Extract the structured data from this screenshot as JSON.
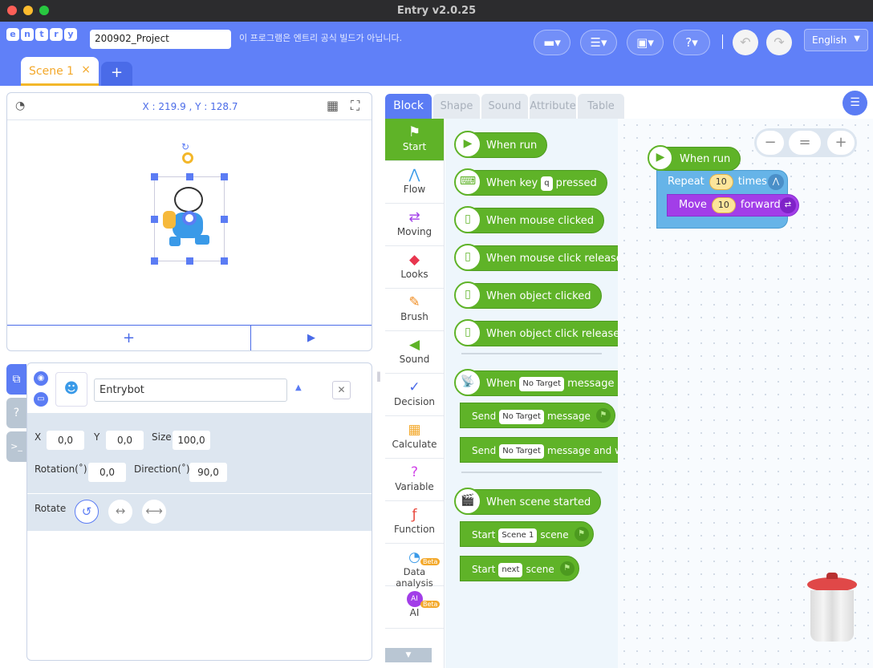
{
  "window": {
    "title": "Entry v2.0.25"
  },
  "header": {
    "logo": "entry",
    "project_name": "200902_Project",
    "notice": "이 프로그램은 엔트리 공식 빌드가 아닙니다.",
    "language": "English",
    "menus": [
      "block-style",
      "file",
      "save",
      "help"
    ]
  },
  "scenes": {
    "tabs": [
      {
        "label": "Scene 1",
        "close": "×"
      }
    ],
    "add": "+"
  },
  "stage": {
    "coords": "X : 219.9 , Y : 128.7",
    "add_button": "+",
    "play_button": "▶"
  },
  "object": {
    "name": "Entrybot",
    "x_label": "X",
    "x": "0,0",
    "y_label": "Y",
    "y": "0,0",
    "size_label": "Size",
    "size": "100,0",
    "rotation_label": "Rotation(˚)",
    "rotation": "0,0",
    "direction_label": "Direction(˚)",
    "direction": "90,0",
    "rotate_label": "Rotate",
    "side_tabs": [
      "object",
      "help",
      "console"
    ]
  },
  "block_tabs": [
    "Block",
    "Shape",
    "Sound",
    "Attribute",
    "Table"
  ],
  "categories": [
    {
      "label": "Start",
      "icon": "⚑"
    },
    {
      "label": "Flow",
      "icon": "⋀"
    },
    {
      "label": "Moving",
      "icon": "⇄"
    },
    {
      "label": "Looks",
      "icon": "◆"
    },
    {
      "label": "Brush",
      "icon": "✎"
    },
    {
      "label": "Sound",
      "icon": "◀"
    },
    {
      "label": "Decision",
      "icon": "✓"
    },
    {
      "label": "Calculate",
      "icon": "▦"
    },
    {
      "label": "Variable",
      "icon": "?"
    },
    {
      "label": "Function",
      "icon": "ƒ"
    },
    {
      "label": "Data analysis",
      "icon": "◔",
      "badge": "Beta"
    },
    {
      "label": "AI",
      "icon": "AI",
      "badge": "Beta"
    }
  ],
  "palette": {
    "when_run": "When run",
    "when_key": [
      "When key",
      "q",
      "pressed"
    ],
    "mouse_clicked": "When mouse clicked",
    "mouse_released": "When mouse click released",
    "object_clicked": "When object clicked",
    "object_released": "When object click released",
    "msg_received": [
      "When",
      "No Target",
      "message received"
    ],
    "send": [
      "Send",
      "No Target",
      "message"
    ],
    "send_wait": [
      "Send",
      "No Target",
      "message and wait"
    ],
    "scene_started": "When scene started",
    "start_scene": [
      "Start",
      "Scene 1",
      "scene"
    ],
    "start_next": [
      "Start",
      "next",
      "scene"
    ]
  },
  "workspace": {
    "when_run": "When run",
    "repeat": [
      "Repeat",
      "10",
      "times"
    ],
    "move": [
      "Move",
      "10",
      "forward"
    ],
    "zoom": [
      "−",
      "=",
      "+"
    ]
  }
}
